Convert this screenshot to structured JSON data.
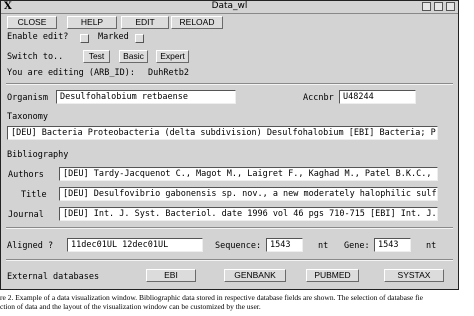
{
  "window": {
    "title": "Data_wl",
    "x_logo": "X"
  },
  "toolbar": {
    "close": "CLOSE",
    "help": "HELP",
    "edit": "EDIT",
    "reload": "RELOAD"
  },
  "status": {
    "enable_edit": "Enable edit?",
    "marked": "Marked"
  },
  "switch": {
    "label": "Switch to..",
    "test": "Test",
    "basic": "Basic",
    "expert": "Expert"
  },
  "editing": {
    "label": "You are editing (ARB_ID):",
    "value": "DuhRetb2"
  },
  "organism": {
    "label": "Organism",
    "value": "Desulfohalobium retbaense"
  },
  "accnbr": {
    "label": "Accnbr",
    "value": "U48244"
  },
  "taxonomy": {
    "label": "Taxonomy",
    "value": "[DEU] Bacteria Proteobacteria (delta subdivision) Desulfohalobium [EBI] Bacteria; Proteo"
  },
  "bibliography": {
    "label": "Bibliography",
    "authors": {
      "label": "Authors",
      "value": "[DEU] Tardy-Jacquenot C., Magot M., Laigret F., Kaghad M., Patel B.K.C., Gueze"
    },
    "title": {
      "label": "Title",
      "value": "[DEU] Desulfovibrio gabonensis sp. nov., a new moderately halophilic  sulfate-r"
    },
    "journal": {
      "label": "Journal",
      "value": "[DEU] Int. J. Syst. Bacteriol. date 1996 vol 46 pgs 710-715 [EBI] Int. J. Syst. B"
    }
  },
  "aligned": {
    "label": "Aligned ?",
    "value": "11dec01UL 12dec01UL"
  },
  "sequence": {
    "label": "Sequence:",
    "value": "1543",
    "unit": "nt"
  },
  "gene": {
    "label": "Gene:",
    "value": "1543",
    "unit": "nt"
  },
  "external": {
    "label": "External databases",
    "ebi": "EBI",
    "genbank": "GENBANK",
    "pubmed": "PUBMED",
    "systax": "SYSTAX"
  },
  "caption": {
    "line1": "re 2. Example of a data visualization window. Bibliographic data stored in respective database fields are shown. The selection of database fie",
    "line2": "ction of data and the layout of the visualization window can be customized by the user."
  }
}
